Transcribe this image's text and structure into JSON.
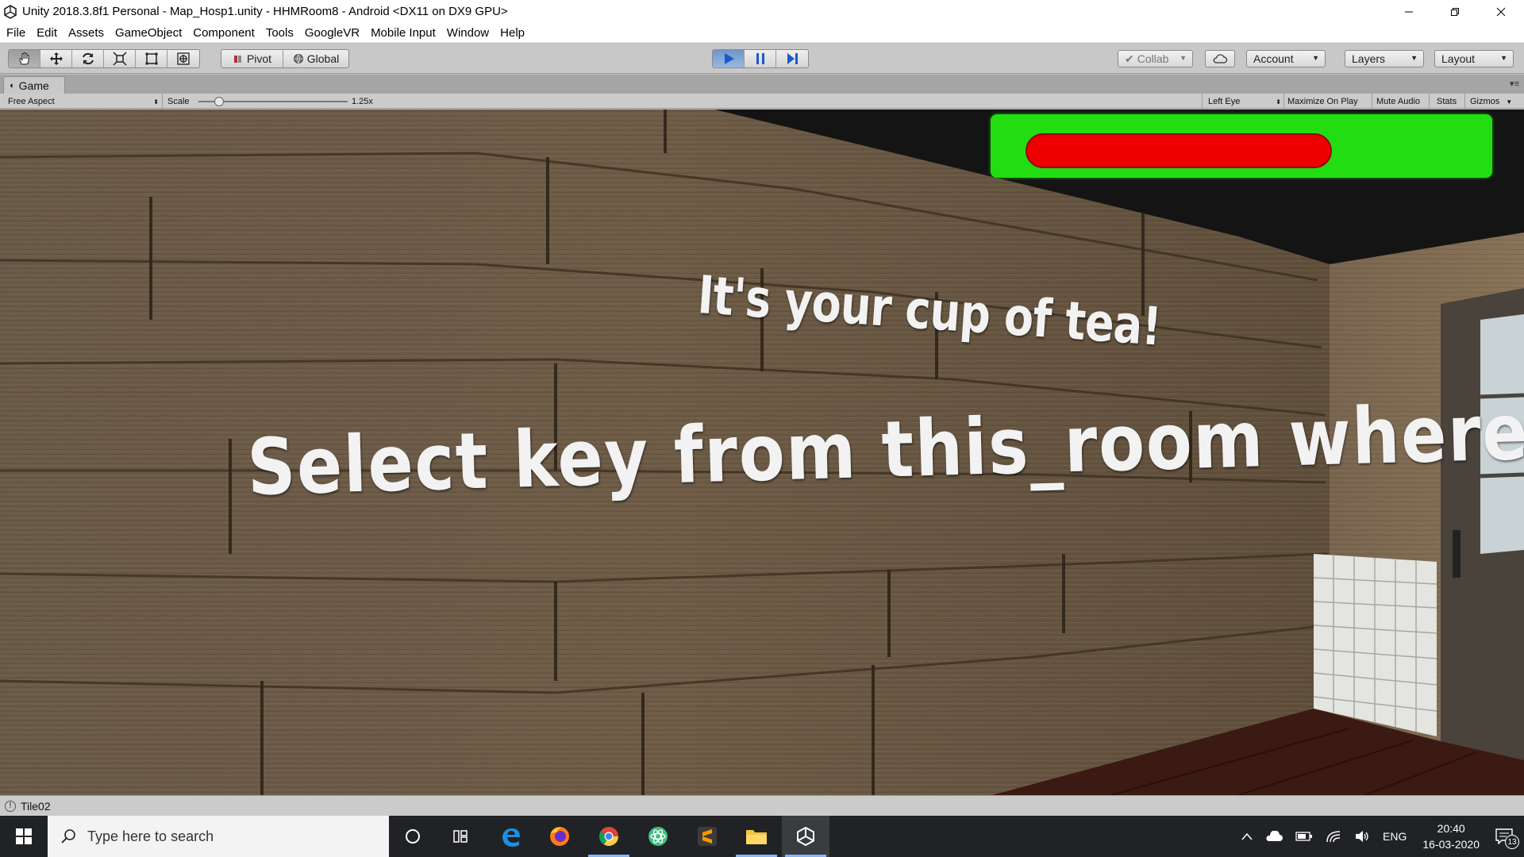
{
  "window": {
    "title": "Unity 2018.3.8f1 Personal - Map_Hosp1.unity - HHMRoom8 - Android <DX11 on DX9 GPU>",
    "icon": "unity-icon",
    "controls": [
      "minimize",
      "restore",
      "close"
    ]
  },
  "menu": [
    "File",
    "Edit",
    "Assets",
    "GameObject",
    "Component",
    "Tools",
    "GoogleVR",
    "Mobile Input",
    "Window",
    "Help"
  ],
  "toolbar": {
    "tools": [
      "hand-tool-icon",
      "move-tool-icon",
      "rotate-tool-icon",
      "scale-tool-icon",
      "rect-tool-icon",
      "transform-tool-icon"
    ],
    "pivot_label": "Pivot",
    "global_label": "Global",
    "play_state": "playing",
    "collab_label": "Collab",
    "account_label": "Account",
    "layers_label": "Layers",
    "layout_label": "Layout",
    "accent_color": "#5a8bd1"
  },
  "game_view": {
    "tab_label": "Game",
    "aspect": "Free Aspect",
    "scale_label": "Scale",
    "scale_value": "1.25x",
    "eye": "Left Eye",
    "maximize_on_play": "Maximize On Play",
    "mute_audio": "Mute Audio",
    "stats": "Stats",
    "gizmos": "Gizmos"
  },
  "scene": {
    "message_1": "It's your cup of tea!",
    "message_2": "Select key from this_room where color='Red'",
    "health_frame_color": "#22dd11",
    "health_bar_color": "#ee0000",
    "health_fill": 0.71
  },
  "status": {
    "text": "Tile02"
  },
  "taskbar": {
    "search_placeholder": "Type here to search",
    "apps": [
      "cortana-icon",
      "task-view-icon",
      "edge-icon",
      "firefox-icon",
      "chrome-icon",
      "atom-icon",
      "sublime-icon",
      "file-explorer-icon",
      "unity-icon"
    ],
    "language": "ENG",
    "time": "20:40",
    "date": "16-03-2020",
    "notifications": "13"
  }
}
